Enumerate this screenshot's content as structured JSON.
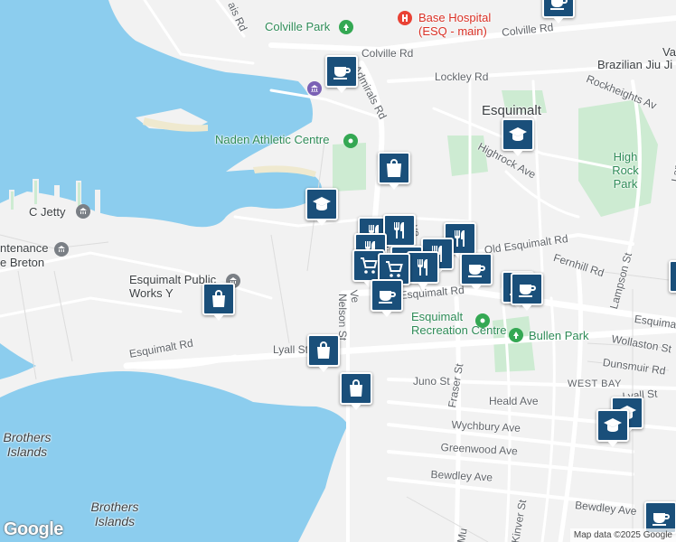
{
  "map": {
    "colors": {
      "water": "#8ccdee",
      "land": "#f2f2f2",
      "park": "#cdebd2",
      "road": "#ffffff",
      "pin": "#1a4f7a"
    },
    "streets": [
      "Colville Rd",
      "Colville Rd",
      "Lockley Rd",
      "Admirals Rd",
      "Rockheights Av",
      "Highrock Ave",
      "Old Esquimalt Rd",
      "Fernhill Rd",
      "Lampson St",
      "Esquimalt Rd",
      "Esquimalt Rd",
      "Esquimalt Rd",
      "Nelson St",
      "Lyall St",
      "Lyall St",
      "Juno St",
      "Heald Ave",
      "Wychbury Ave",
      "Greenwood Ave",
      "Bewdley Ave",
      "Bewdley Ave",
      "Wollaston St",
      "Dunsmuir Rd",
      "Fraser St",
      "Kinver St",
      "Mu",
      "Ve",
      "ve",
      "ais Rd",
      "Lam"
    ],
    "places": [
      "Esquimalt",
      "High Rock Park",
      "Colville Park",
      "Base Hospital (ESQ - main)",
      "Naden Athletic Centre",
      "Esquimalt Recreation Centre",
      "Bullen Park",
      "Brazilian Jiu Ji",
      "Va",
      "C Jetty",
      "Esquimalt Public Works Y",
      "ntenance",
      "e Breton",
      "Brothers Islands",
      "Brothers Islands",
      "WEST BAY"
    ],
    "pins": [
      "cafe-pin",
      "cafe-pin",
      "cafe-pin",
      "cafe-pin",
      "cafe-pin",
      "cafe-pin",
      "cafe-pin",
      "shop-pin",
      "shop-pin",
      "shop-pin",
      "shop-pin",
      "restaurant-pin",
      "restaurant-pin",
      "restaurant-pin",
      "restaurant-pin",
      "restaurant-pin",
      "restaurant-pin",
      "restaurant-pin",
      "grocery-pin",
      "grocery-pin",
      "school-pin",
      "school-pin",
      "school-pin",
      "school-pin"
    ],
    "logo": "Google",
    "attribution": "Map data ©2025 Google"
  }
}
